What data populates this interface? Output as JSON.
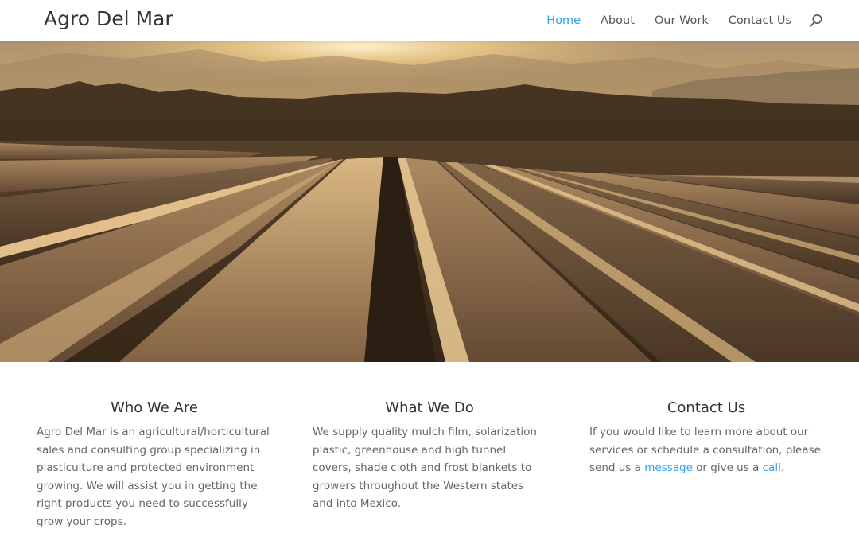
{
  "header": {
    "logo": "Agro Del Mar",
    "nav": [
      "Home",
      "About",
      "Our Work",
      "Contact Us"
    ],
    "active_nav": "Home",
    "search_icon": "search-icon"
  },
  "hero": {
    "image": "sunset-over-plastic-mulch-covered-field-rows"
  },
  "sections": [
    {
      "title": "Who We Are",
      "text": "Agro Del Mar is an agricultural/horticultural sales and consulting group specializing in plasticulture and protected environment growing. We will assist you in getting the right products you need to successfully grow your crops."
    },
    {
      "title": "What We Do",
      "text": "We supply quality mulch film, solarization plastic, greenhouse and high tunnel covers, shade cloth and frost blankets to growers throughout the Western states and into Mexico."
    },
    {
      "title": "Contact Us",
      "text_before": "If you would like to learn more about our services or schedule a consultation, please send us a ",
      "link1": "message",
      "text_middle": " or give us a ",
      "link2": "call",
      "text_after": "."
    }
  ],
  "colors": {
    "accent": "#2ea3f2",
    "nav_text": "#555555",
    "heading": "#333333",
    "body_text": "#666666"
  }
}
